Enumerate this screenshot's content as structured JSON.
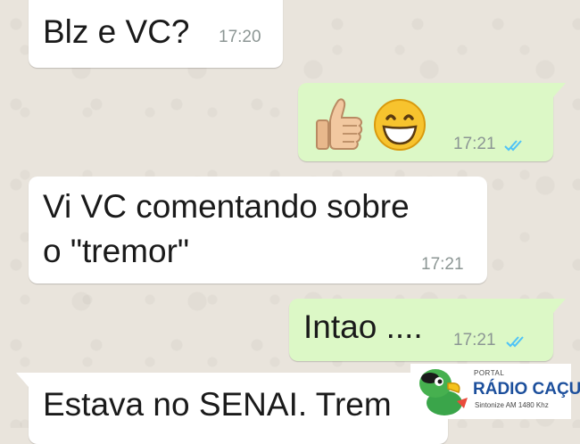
{
  "colors": {
    "chat_background": "#e9e4dc",
    "incoming_bubble": "#ffffff",
    "outgoing_bubble": "#dcf8c6",
    "read_ticks": "#4fc3f7",
    "timestamp": "#8c9694",
    "logo_brand": "#1c4f9c"
  },
  "messages": [
    {
      "direction": "incoming",
      "text": "Blz e VC?",
      "time": "17:20"
    },
    {
      "direction": "outgoing",
      "emojis": [
        "thumbs-up-icon",
        "grinning-face-icon"
      ],
      "time": "17:21",
      "status": "read"
    },
    {
      "direction": "incoming",
      "text_line1": "Vi VC comentando sobre",
      "text_line2": "o \"tremor\"",
      "time": "17:21"
    },
    {
      "direction": "outgoing",
      "text": "Intao ....",
      "time": "17:21",
      "status": "read"
    },
    {
      "direction": "incoming",
      "text": "Estava no SENAI. Trem"
    }
  ],
  "watermark": {
    "portal": "PORTAL",
    "brand": "RÁDIO CAÇULA",
    "tagline": "Sintonize AM 1480 Khz",
    "mascot_icon": "parrot-mascot-icon"
  }
}
